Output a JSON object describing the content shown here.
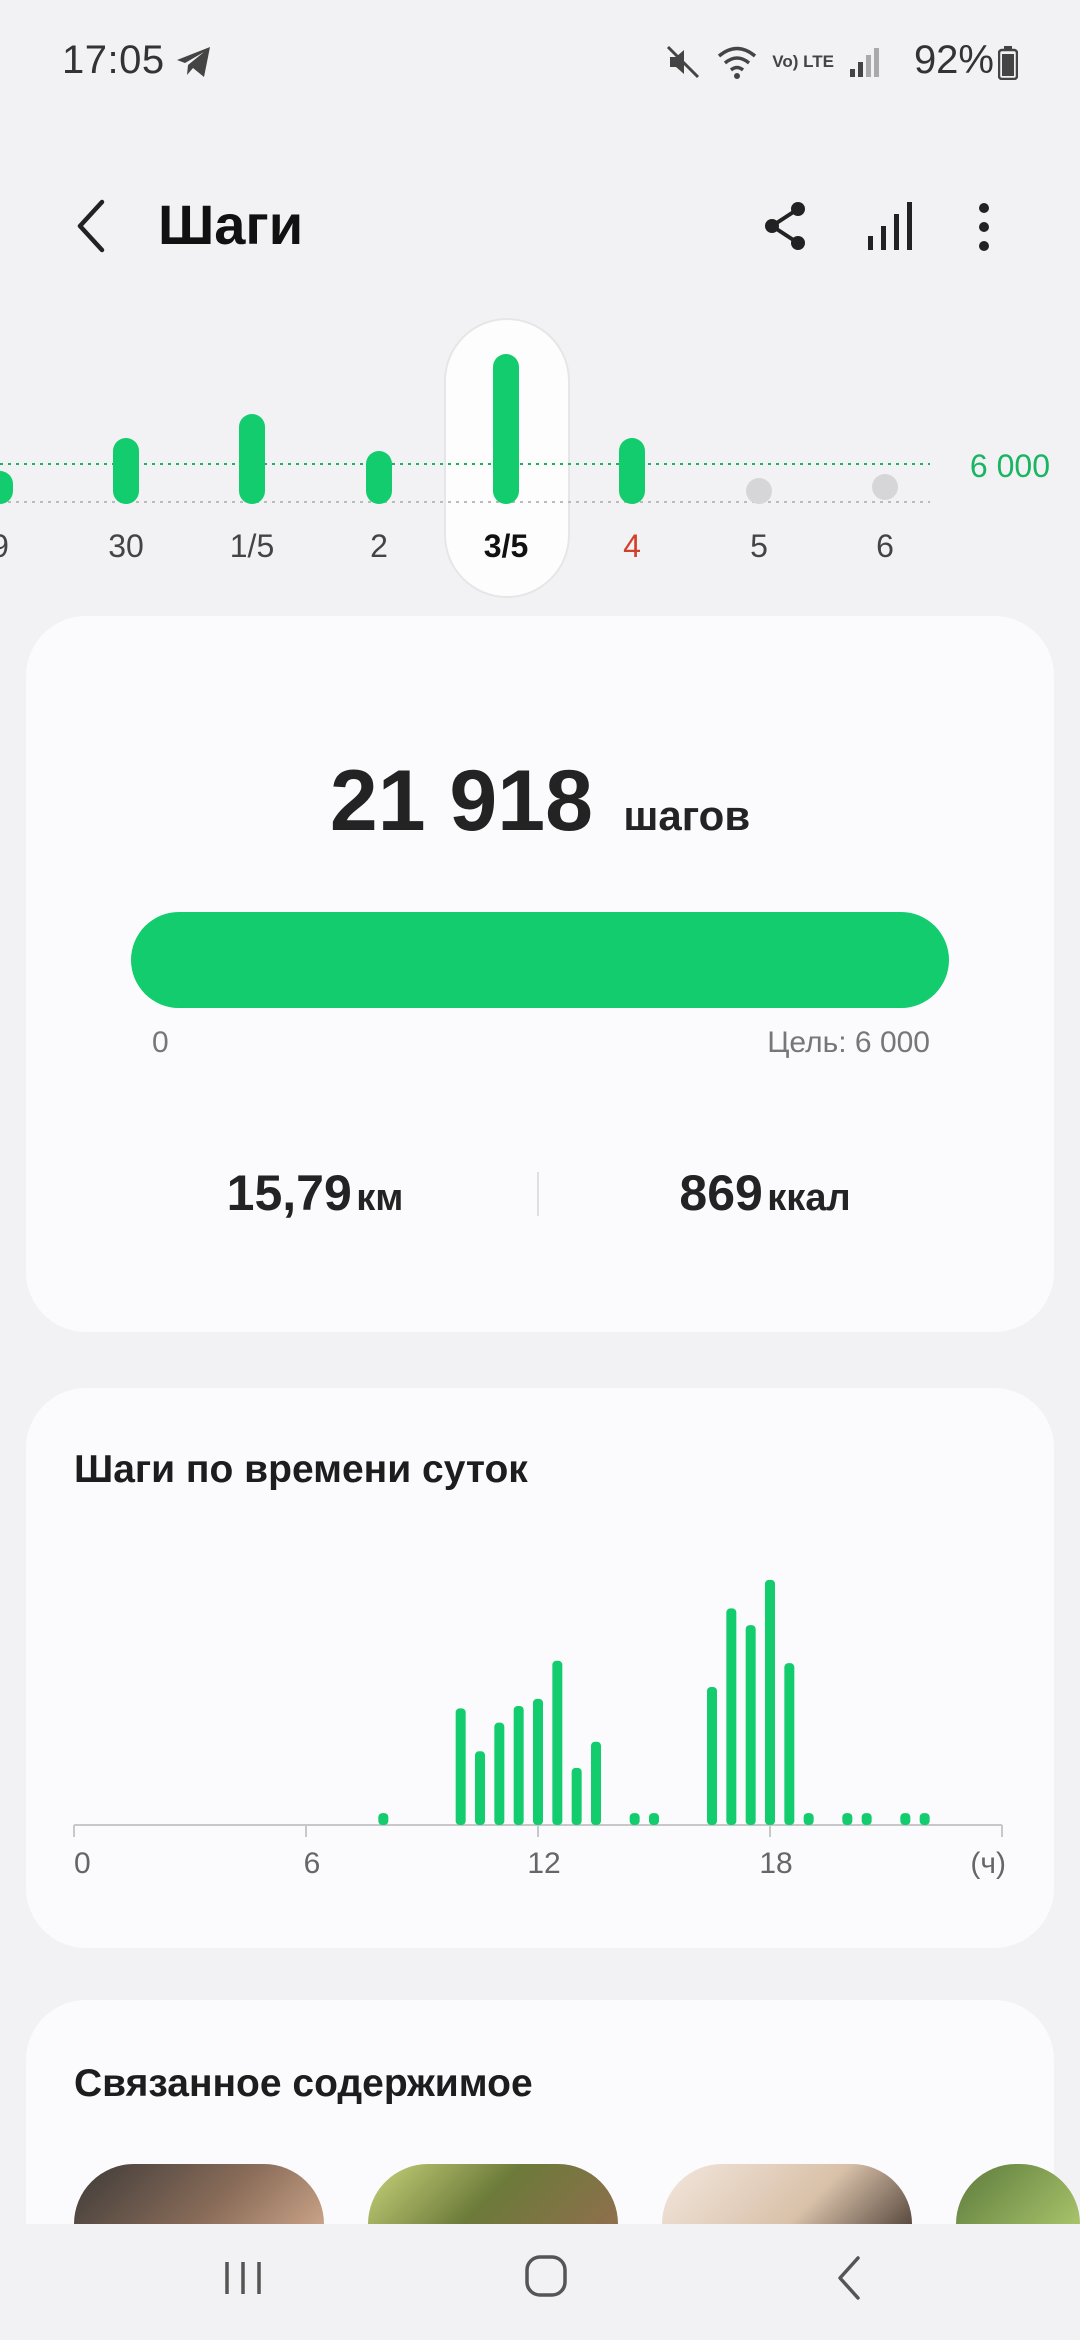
{
  "status_bar": {
    "time": "17:05",
    "battery_percent": "92%",
    "network": "Vo) LTE",
    "icons": [
      "telegram-icon",
      "mute-icon",
      "wifi-icon",
      "volte-icon",
      "signal-icon",
      "battery-icon"
    ]
  },
  "header": {
    "title": "Шаги",
    "actions": [
      "share-icon",
      "stats-icon",
      "more-icon"
    ]
  },
  "day_selector": {
    "goal_label": "6 000",
    "days": [
      {
        "label": "9",
        "goal_ratio": 0.8
      },
      {
        "label": "30",
        "goal_ratio": 1.6
      },
      {
        "label": "1/5",
        "goal_ratio": 2.2
      },
      {
        "label": "2",
        "goal_ratio": 1.3
      },
      {
        "label": "3/5",
        "goal_ratio": 3.65,
        "selected": true
      },
      {
        "label": "4",
        "goal_ratio": 1.6,
        "highlight": "red"
      },
      {
        "label": "5",
        "goal_ratio": 0.5,
        "empty": true
      },
      {
        "label": "6",
        "goal_ratio": 0.1,
        "empty": true
      }
    ]
  },
  "summary": {
    "steps": "21 918",
    "steps_unit": "шагов",
    "progress_fraction": 1.0,
    "progress_min": "0",
    "goal_text": "Цель: 6 000",
    "distance_value": "15,79",
    "distance_unit": "км",
    "calories_value": "869",
    "calories_unit": "ккал"
  },
  "hourly": {
    "title": "Шаги по времени суток",
    "x_labels": [
      "0",
      "6",
      "12",
      "18"
    ],
    "unit_label": "(ч)"
  },
  "chart_data": {
    "type": "bar",
    "title": "Шаги по времени суток",
    "x_unit": "(ч)",
    "xlim": [
      0,
      24
    ],
    "x_ticks": [
      0,
      6,
      12,
      18
    ],
    "x": [
      8,
      10,
      10.5,
      11,
      11.5,
      12,
      12.5,
      13,
      13.5,
      14.5,
      15,
      16.5,
      17,
      17.5,
      18,
      18.5,
      19,
      20,
      20.5,
      21.5,
      22
    ],
    "values": [
      5,
      49,
      31,
      43,
      50,
      53,
      69,
      24,
      35,
      5,
      5,
      58,
      91,
      84,
      103,
      68,
      5,
      5,
      5,
      5,
      5
    ]
  },
  "related": {
    "title": "Связанное содержимое"
  },
  "colors": {
    "accent_green": "#12cc6e",
    "goal_text_green": "#19b562",
    "weekend_red": "#d0402b",
    "background": "#f2f2f4",
    "card": "#fbfbfd"
  },
  "nav": {
    "buttons": [
      "recents-icon",
      "home-icon",
      "back-icon"
    ]
  }
}
